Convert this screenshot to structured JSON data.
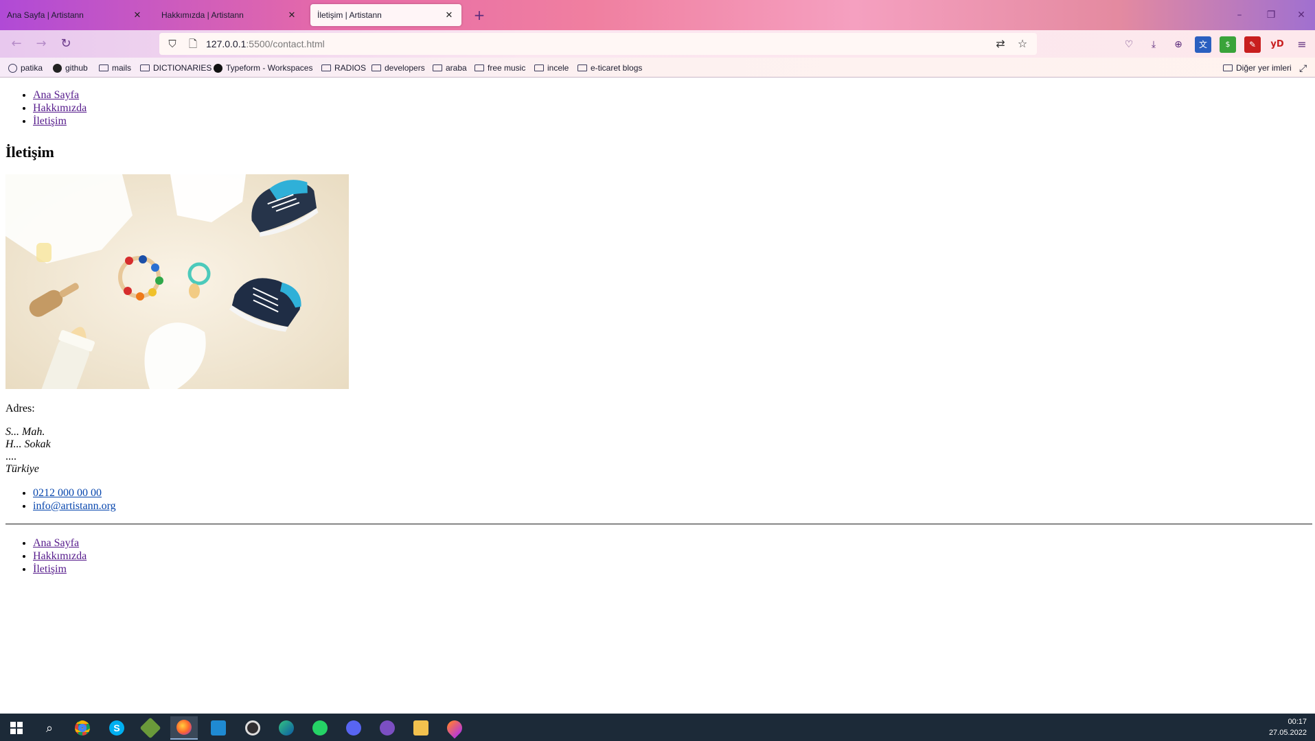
{
  "browser": {
    "tabs": [
      {
        "label": "Ana Sayfa | Artistann",
        "active": false
      },
      {
        "label": "Hakkımızda | Artistann",
        "active": false
      },
      {
        "label": "İletişim | Artistann",
        "active": true
      }
    ],
    "url": {
      "host": "127.0.0.1",
      "rest": ":5500/contact.html"
    },
    "bookmarks": [
      {
        "label": "patika",
        "icon": "globe-icon"
      },
      {
        "label": "github",
        "icon": "github-icon"
      },
      {
        "label": "mails",
        "icon": "folder-icon"
      },
      {
        "label": "DICTIONARIES",
        "icon": "folder-icon"
      },
      {
        "label": "Typeform - Workspaces",
        "icon": "typeform-icon"
      },
      {
        "label": "RADIOS",
        "icon": "folder-icon"
      },
      {
        "label": "developers",
        "icon": "folder-icon"
      },
      {
        "label": "araba",
        "icon": "folder-icon"
      },
      {
        "label": "free music",
        "icon": "folder-icon"
      },
      {
        "label": "incele",
        "icon": "folder-icon"
      },
      {
        "label": "e-ticaret blogs",
        "icon": "folder-icon"
      }
    ],
    "other_bookmarks": "Diğer yer imleri",
    "extensions": {
      "yd_label": "yD"
    }
  },
  "page": {
    "nav": [
      "Ana Sayfa",
      "Hakkımızda",
      "İletişim"
    ],
    "title": "İletişim",
    "address_label": "Adres:",
    "address_lines": [
      "S... Mah.",
      "H... Sokak",
      "....",
      "Türkiye"
    ],
    "contacts": [
      "0212 000 00 00",
      "info@artistann.org"
    ],
    "footer_nav": [
      "Ana Sayfa",
      "Hakkımızda",
      "İletişim"
    ]
  },
  "taskbar": {
    "time": "00:17",
    "date": "27.05.2022"
  },
  "colors": {
    "link_visited": "#551a8b",
    "link_blue": "#0645ad",
    "taskbar": "#1c2a38"
  }
}
